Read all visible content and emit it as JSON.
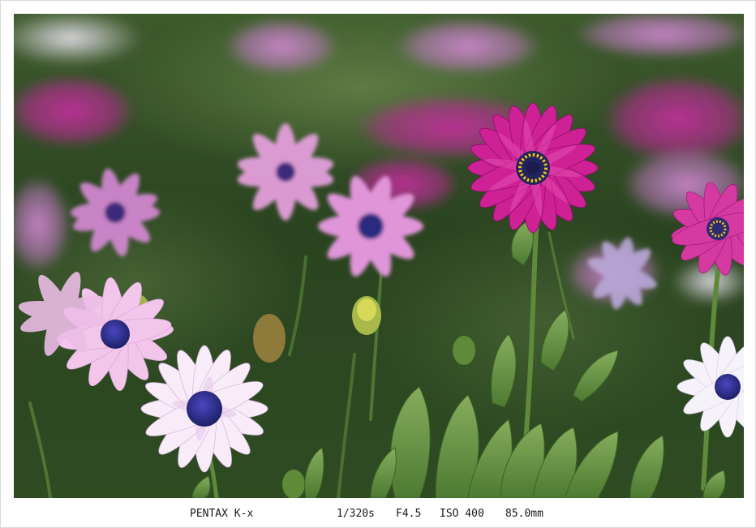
{
  "exif": {
    "camera": "PENTAX K-x",
    "shutter": "1/320s",
    "aperture": "F4.5",
    "iso": "ISO 400",
    "focal_length": "85.0mm"
  },
  "colors": {
    "frame_background": "#ffffff",
    "foliage_dark": "#1f3517",
    "foliage_light": "#6f9a45",
    "petal_magenta": "#c21f8e",
    "petal_pink": "#d77fcf",
    "petal_white": "#f4eef8",
    "flower_center": "#2a2a8a",
    "pollen": "#f2c417"
  }
}
